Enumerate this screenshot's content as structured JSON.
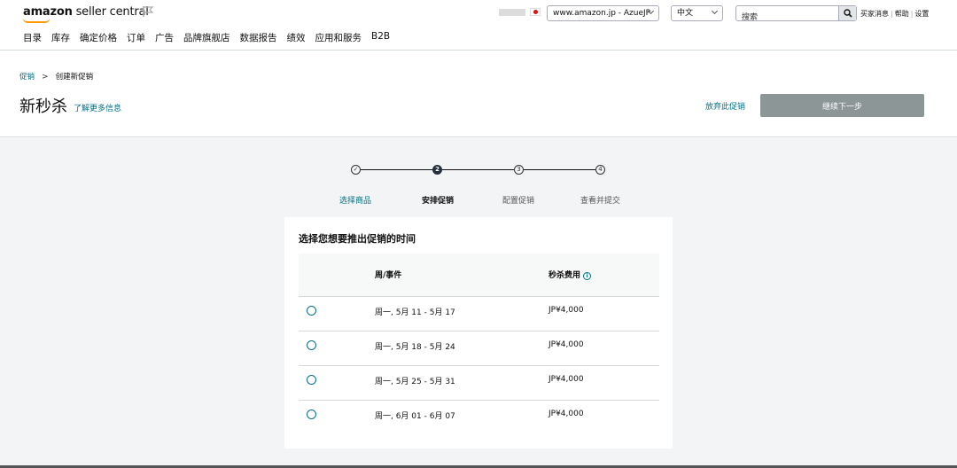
{
  "header": {
    "logo_bold": "amazon",
    "logo_rest": " seller central",
    "marketplace": "www.amazon.jp - AzueJP",
    "language": "中文",
    "search_placeholder": "搜索",
    "util_links": [
      "买家消息",
      "帮助",
      "设置"
    ]
  },
  "nav": [
    "目录",
    "库存",
    "确定价格",
    "订单",
    "广告",
    "品牌旗舰店",
    "数据报告",
    "绩效",
    "应用和服务",
    "B2B"
  ],
  "breadcrumb": {
    "parent": "促销",
    "separator": ">",
    "current": "创建新促销"
  },
  "page": {
    "title": "新秒杀",
    "learn_more": "了解更多信息",
    "abandon": "放弃此促销",
    "continue": "继续下一步"
  },
  "steps": [
    {
      "marker": "✓",
      "label": "选择商品",
      "state": "done"
    },
    {
      "marker": "2",
      "label": "安排促销",
      "state": "active"
    },
    {
      "marker": "3",
      "label": "配置促销",
      "state": "todo"
    },
    {
      "marker": "4",
      "label": "查看并提交",
      "state": "todo"
    }
  ],
  "schedule": {
    "title": "选择您想要推出促销的时间",
    "columns": {
      "week": "周/事件",
      "fee": "秒杀费用"
    },
    "rows": [
      {
        "week": "周一, 5月 11 - 5月 17",
        "fee": "JP¥4,000"
      },
      {
        "week": "周一, 5月 18 - 5月 24",
        "fee": "JP¥4,000"
      },
      {
        "week": "周一, 5月 25 - 5月 31",
        "fee": "JP¥4,000"
      },
      {
        "week": "周一, 6月 01 - 6月 07",
        "fee": "JP¥4,000"
      }
    ]
  },
  "colors": {
    "link": "#007185",
    "brand_orange": "#ff9900",
    "button_disabled": "#8c9696",
    "step_active": "#232f3e"
  }
}
